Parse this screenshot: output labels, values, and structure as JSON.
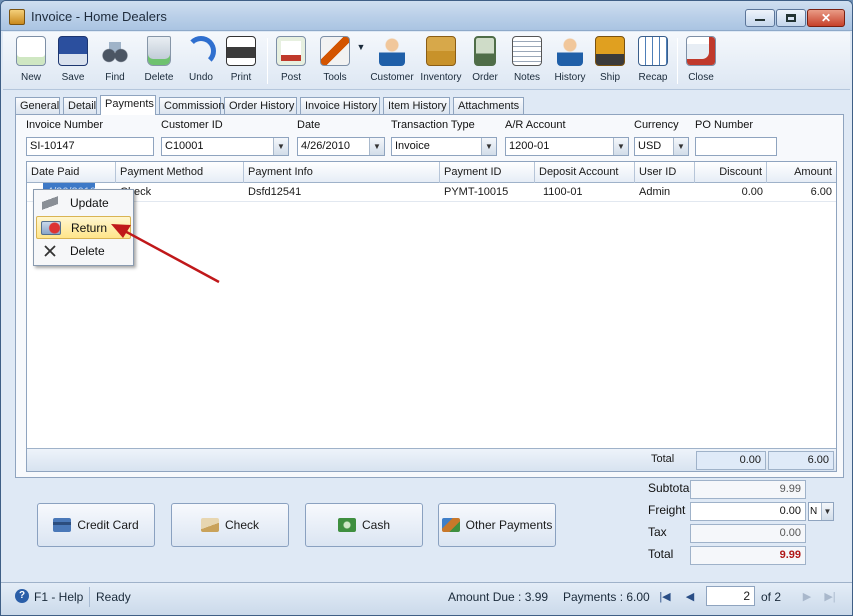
{
  "window": {
    "title": "Invoice - Home Dealers",
    "controls": {
      "minimize": "minimize-icon",
      "maximize": "maximize-icon",
      "close": "close-icon",
      "close_glyph": "✕"
    }
  },
  "toolbar": [
    {
      "label": "New",
      "icon": "new-document-icon",
      "color": "#5a9e3a"
    },
    {
      "label": "Save",
      "icon": "floppy-disk-icon",
      "color": "#2b4f9e"
    },
    {
      "label": "Find",
      "icon": "binoculars-icon",
      "color": "#4b5563"
    },
    {
      "label": "Delete",
      "icon": "recycle-bin-icon",
      "color": "#3e8f3e"
    },
    {
      "label": "Undo",
      "icon": "undo-arrow-icon",
      "color": "#2f6fcf"
    },
    {
      "label": "Print",
      "icon": "printer-icon",
      "color": "#3b3b3b"
    },
    {
      "label": "Post",
      "icon": "post-document-icon",
      "color": "#c0392b"
    },
    {
      "label": "Tools",
      "icon": "tools-icon",
      "color": "#d35400"
    },
    {
      "label": "Customer",
      "icon": "customer-person-icon",
      "color": "#1f5fa8"
    },
    {
      "label": "Inventory",
      "icon": "inventory-boxes-icon",
      "color": "#c8922a"
    },
    {
      "label": "Order",
      "icon": "order-pda-icon",
      "color": "#4f6d48"
    },
    {
      "label": "Notes",
      "icon": "notes-pencil-icon",
      "color": "#555555"
    },
    {
      "label": "History",
      "icon": "history-person-icon",
      "color": "#1f5fa8"
    },
    {
      "label": "Ship",
      "icon": "ship-forklift-icon",
      "color": "#e0a020"
    },
    {
      "label": "Recap",
      "icon": "recap-sheet-icon",
      "color": "#4e7fb8"
    },
    {
      "label": "Close",
      "icon": "close-window-icon",
      "color": "#c0392b"
    }
  ],
  "tools_dropdown_glyph": "▼",
  "tabs": [
    "General",
    "Detail",
    "Payments",
    "Commission",
    "Order History",
    "Invoice History",
    "Item History",
    "Attachments"
  ],
  "active_tab": "Payments",
  "header_fields": {
    "invoice_number": {
      "label": "Invoice Number",
      "value": "SI-10147"
    },
    "customer_id": {
      "label": "Customer ID",
      "value": "C10001"
    },
    "date": {
      "label": "Date",
      "value": "4/26/2010"
    },
    "transaction_type": {
      "label": "Transaction Type",
      "value": "Invoice"
    },
    "ar_account": {
      "label": "A/R Account",
      "value": "1200-01"
    },
    "currency": {
      "label": "Currency",
      "value": "USD"
    },
    "po_number": {
      "label": "PO Number",
      "value": ""
    },
    "combo_arrow": "▼"
  },
  "grid": {
    "columns": [
      "Date Paid",
      "Payment Method",
      "Payment Info",
      "Payment ID",
      "Deposit Account",
      "User ID",
      "Discount",
      "Amount"
    ],
    "rows": [
      {
        "date_paid": "4/26/2010",
        "payment_method": "Check",
        "payment_info": "Dsfd12541",
        "payment_id": "PYMT-10015",
        "deposit_account": "1100-01",
        "user_id": "Admin",
        "discount": "0.00",
        "amount": "6.00"
      }
    ],
    "footer": {
      "label": "Total",
      "discount_total": "0.00",
      "amount_total": "6.00"
    }
  },
  "context_menu": [
    {
      "label": "Update",
      "icon": "update-eraser-icon"
    },
    {
      "label": "Return",
      "icon": "return-icon",
      "highlighted": true
    },
    {
      "label": "Delete",
      "icon": "delete-x-icon"
    }
  ],
  "payment_buttons": [
    {
      "label": "Credit Card",
      "icon": "credit-card-icon",
      "color": "#4a78b8"
    },
    {
      "label": "Check",
      "icon": "check-icon",
      "color": "#c9a25a"
    },
    {
      "label": "Cash",
      "icon": "cash-icon",
      "color": "#3f8f3f"
    },
    {
      "label": "Other Payments",
      "icon": "other-payments-icon",
      "color": "#c8782a"
    }
  ],
  "totals": {
    "subtotal": {
      "label": "Subtotal",
      "value": "9.99"
    },
    "freight": {
      "label": "Freight",
      "value": "0.00",
      "option": "N"
    },
    "tax": {
      "label": "Tax",
      "value": "0.00"
    },
    "total": {
      "label": "Total",
      "value": "9.99",
      "color": "#b01818"
    }
  },
  "statusbar": {
    "help": "F1 - Help",
    "status": "Ready",
    "amount_due": "Amount Due : 3.99",
    "payments": "Payments : 6.00",
    "page": "2",
    "of_pages": "of  2",
    "nav": {
      "first": "|◀",
      "prev": "◀",
      "next": "▶",
      "last": "▶|"
    }
  },
  "colors": {
    "window_bg": "#dfe9f5",
    "accent": "#3d79c7",
    "annotation_arrow": "#c0181a"
  }
}
